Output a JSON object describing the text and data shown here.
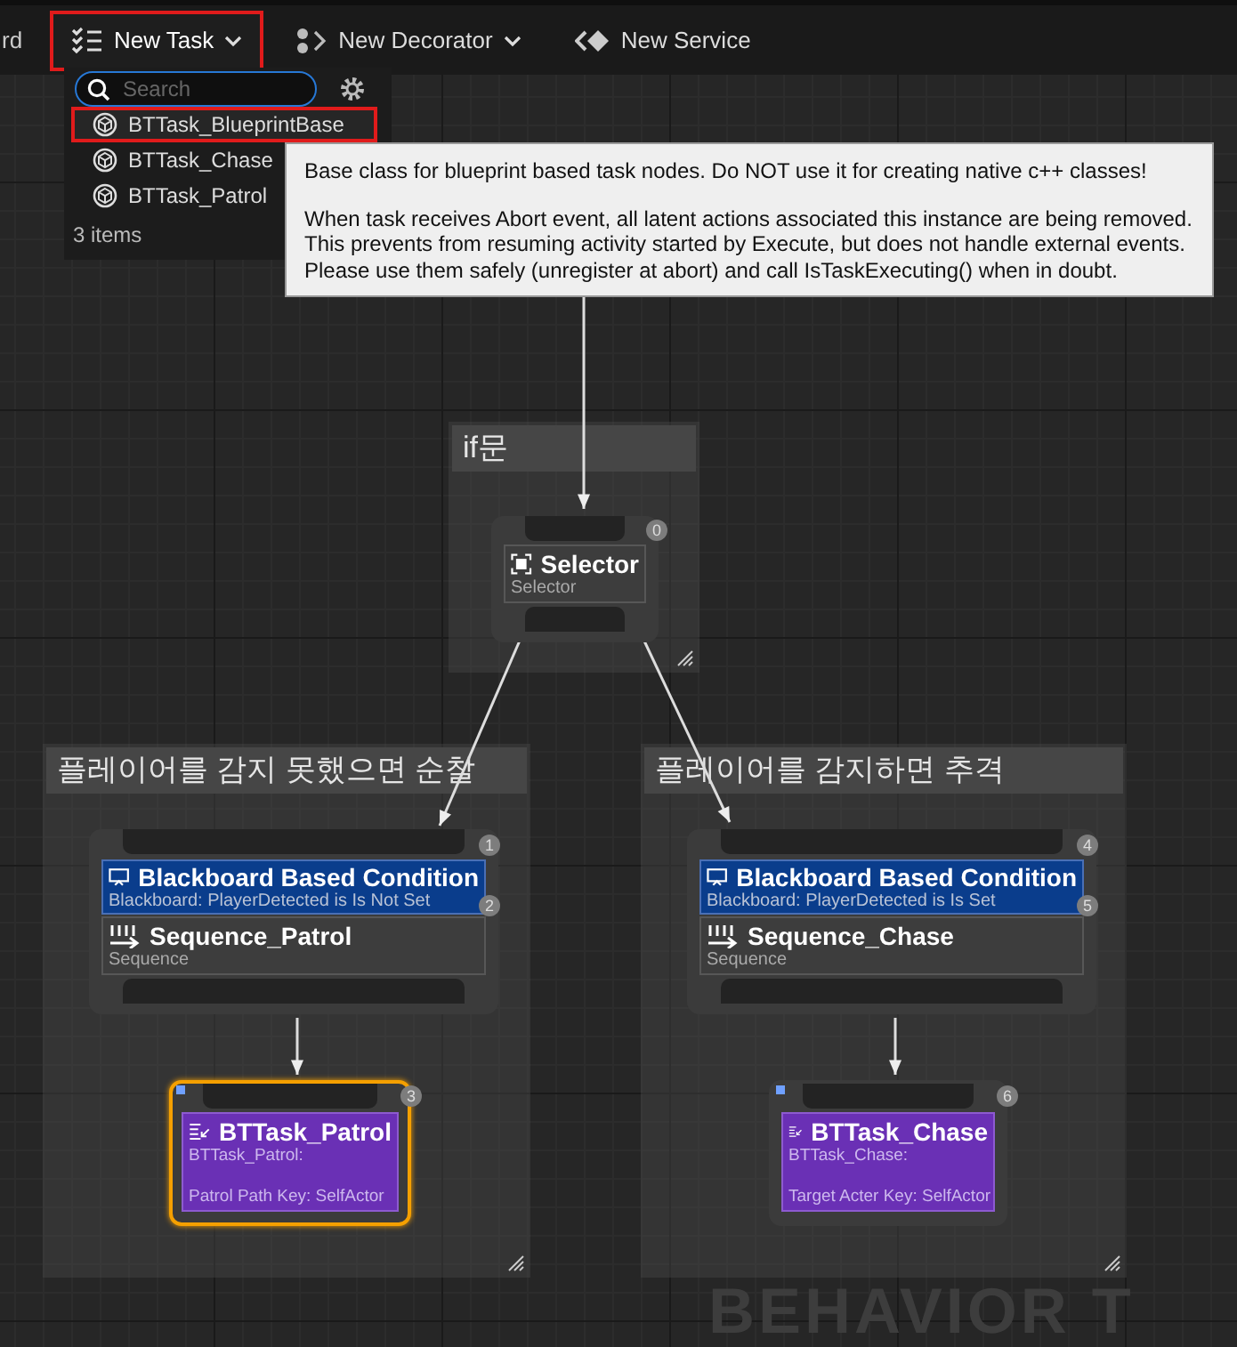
{
  "toolbar": {
    "cut_label": "rd",
    "buttons": [
      {
        "label": "New Task",
        "kind": "task",
        "caret": true,
        "selected": true
      },
      {
        "label": "New Decorator",
        "kind": "decorator",
        "caret": true,
        "selected": false
      },
      {
        "label": "New Service",
        "kind": "service",
        "caret": false,
        "selected": false
      }
    ]
  },
  "dropdown": {
    "search": {
      "placeholder": "Search"
    },
    "items": [
      {
        "label": "BTTask_BlueprintBase",
        "selected": true
      },
      {
        "label": "BTTask_Chase",
        "selected": false
      },
      {
        "label": "BTTask_Patrol",
        "selected": false
      }
    ],
    "count": "3 items"
  },
  "tooltip": {
    "paragraphs": [
      [
        "Base class for blueprint based task nodes. Do NOT use it for creating native c++ classes!"
      ],
      [
        "When task receives Abort event, all latent actions associated this instance are being removed.",
        "This prevents from resuming activity started by Execute, but does not handle external events.",
        "Please use them safely (unregister at abort) and call IsTaskExecuting() when in doubt."
      ]
    ]
  },
  "graph": {
    "comments": [
      {
        "title": "if문"
      },
      {
        "title": "플레이어를 감지 못했으면 순찰"
      },
      {
        "title": "플레이어를 감지하면 추격"
      }
    ],
    "nodes": [
      {
        "kind": "selector",
        "index": "0",
        "title": "Selector",
        "subtitle": "Selector"
      },
      {
        "kind": "sequence",
        "index": "2",
        "title": "Sequence_Patrol",
        "subtitle": "Sequence",
        "decorators": [
          {
            "index": "1",
            "title": "Blackboard Based Condition",
            "subtitle": "Blackboard: PlayerDetected is Is Not Set"
          }
        ]
      },
      {
        "kind": "sequence",
        "index": "5",
        "title": "Sequence_Chase",
        "subtitle": "Sequence",
        "decorators": [
          {
            "index": "4",
            "title": "Blackboard Based Condition",
            "subtitle": "Blackboard: PlayerDetected is Is Set"
          }
        ]
      },
      {
        "kind": "task",
        "index": "3",
        "title": "BTTask_Patrol",
        "lines": [
          "BTTask_Patrol:",
          "Patrol Path Key: SelfActor"
        ],
        "selected": true
      },
      {
        "kind": "task",
        "index": "6",
        "title": "BTTask_Chase",
        "lines": [
          "BTTask_Chase:",
          "Target Acter Key: SelfActor"
        ],
        "selected": false
      }
    ],
    "watermark": "BEHAVIOR T"
  }
}
